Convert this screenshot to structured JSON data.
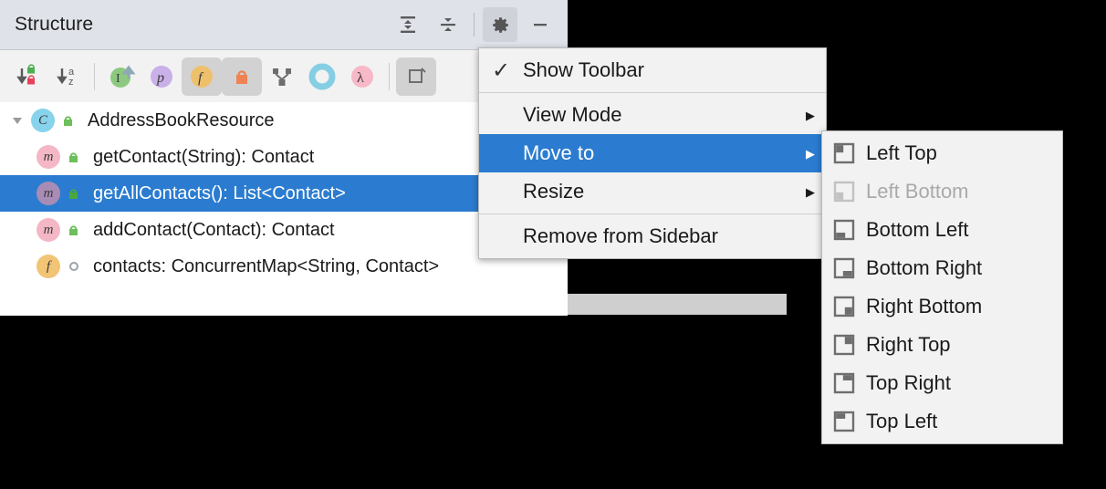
{
  "window": {
    "title": "Structure",
    "header_buttons": [
      {
        "name": "expand-all-icon",
        "label": "Expand All"
      },
      {
        "name": "collapse-all-icon",
        "label": "Collapse All"
      },
      {
        "name": "gear-icon",
        "label": "Options",
        "active": true
      },
      {
        "name": "minimize-icon",
        "label": "Hide"
      }
    ]
  },
  "toolbar": {
    "buttons": [
      {
        "name": "sort-by-visibility-icon",
        "label": "Sort by Visibility",
        "pressed": false
      },
      {
        "name": "sort-alphabetically-icon",
        "label": "Sort Alphabetically",
        "pressed": false
      },
      {
        "name": "show-inherited-icon",
        "label": "Show Inherited",
        "pressed": false
      },
      {
        "name": "show-properties-icon",
        "label": "Show Properties",
        "pressed": false,
        "glyph": "p"
      },
      {
        "name": "show-fields-icon",
        "label": "Show Fields",
        "pressed": true,
        "glyph": "f"
      },
      {
        "name": "show-non-public-icon",
        "label": "Show Non-Public",
        "pressed": true
      },
      {
        "name": "group-by-inheritance-icon",
        "label": "Group by Inheritance",
        "pressed": false
      },
      {
        "name": "show-anonymous-classes-icon",
        "label": "Show Anonymous Classes",
        "pressed": false
      },
      {
        "name": "show-lambdas-icon",
        "label": "Show Lambdas",
        "pressed": false,
        "glyph": "λ"
      },
      {
        "name": "autoscroll-icon",
        "label": "Autoscroll",
        "pressed": true
      }
    ]
  },
  "tree": {
    "rows": [
      {
        "label": "AddressBookResource",
        "kind": "class",
        "kind_glyph": "C",
        "kind_color": "#87d3ec",
        "visibility": "public",
        "indent": 0,
        "expanded": true,
        "selected": false
      },
      {
        "label": "getContact(String): Contact",
        "kind": "method",
        "kind_glyph": "m",
        "kind_color": "#f4b7c5",
        "visibility": "public",
        "indent": 1,
        "selected": false
      },
      {
        "label": "getAllContacts(): List<Contact>",
        "kind": "method",
        "kind_glyph": "m",
        "kind_color": "#a88cb5",
        "visibility": "public",
        "indent": 1,
        "selected": true
      },
      {
        "label": "addContact(Contact): Contact",
        "kind": "method",
        "kind_glyph": "m",
        "kind_color": "#f4b7c5",
        "visibility": "public",
        "indent": 1,
        "selected": false
      },
      {
        "label": "contacts: ConcurrentMap<String, Contact>",
        "kind": "field",
        "kind_glyph": "f",
        "kind_color": "#f2c475",
        "visibility": "private",
        "indent": 1,
        "selected": false
      }
    ]
  },
  "main_menu": {
    "items": [
      {
        "label": "Show Toolbar",
        "checked": true,
        "has_submenu": false,
        "selected": false,
        "name": "menu-item-show-toolbar"
      },
      {
        "label": "View Mode",
        "checked": false,
        "has_submenu": true,
        "selected": false,
        "name": "menu-item-view-mode"
      },
      {
        "label": "Move to",
        "checked": false,
        "has_submenu": true,
        "selected": true,
        "name": "menu-item-move-to"
      },
      {
        "label": "Resize",
        "checked": false,
        "has_submenu": true,
        "selected": false,
        "name": "menu-item-resize"
      },
      {
        "label": "Remove from Sidebar",
        "checked": false,
        "has_submenu": false,
        "selected": false,
        "name": "menu-item-remove-from-sidebar"
      }
    ],
    "check_glyph": "✓",
    "arrow_glyph": "▶"
  },
  "submenu": {
    "items": [
      {
        "label": "Left Top",
        "icon": "dock-left-top-icon",
        "disabled": false
      },
      {
        "label": "Left Bottom",
        "icon": "dock-left-bottom-icon",
        "disabled": true
      },
      {
        "label": "Bottom Left",
        "icon": "dock-bottom-left-icon",
        "disabled": false
      },
      {
        "label": "Bottom Right",
        "icon": "dock-bottom-right-icon",
        "disabled": false
      },
      {
        "label": "Right Bottom",
        "icon": "dock-right-bottom-icon",
        "disabled": false
      },
      {
        "label": "Right Top",
        "icon": "dock-right-top-icon",
        "disabled": false
      },
      {
        "label": "Top Right",
        "icon": "dock-top-right-icon",
        "disabled": false
      },
      {
        "label": "Top Left",
        "icon": "dock-top-left-icon",
        "disabled": false
      }
    ]
  },
  "colors": {
    "selection": "#2b7cd0",
    "header_bg": "#dfe2e9",
    "toolbar_bg": "#f2f2f2",
    "menu_bg": "#f2f2f2",
    "panel_bg": "#ffffff",
    "backdrop": "#000000"
  }
}
